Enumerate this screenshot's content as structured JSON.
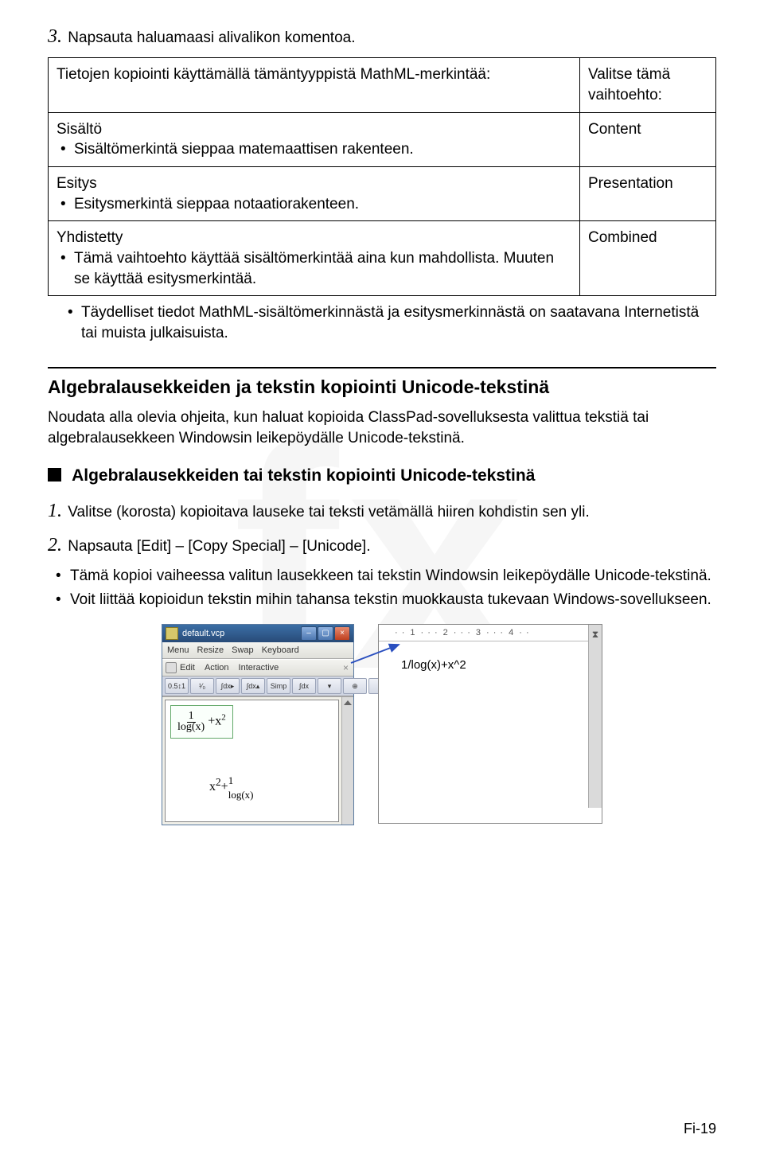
{
  "step3": "Napsauta haluamaasi alivalikon komentoa.",
  "table": {
    "header_left": "Tietojen kopiointi käyttämällä tämäntyyppistä MathML-merkintää:",
    "header_right": "Valitse tämä vaihtoehto:",
    "rows": [
      {
        "title": "Sisältö",
        "desc": "Sisältömerkintä sieppaa matemaattisen rakenteen.",
        "right": "Content"
      },
      {
        "title": "Esitys",
        "desc": "Esitysmerkintä sieppaa notaatiorakenteen.",
        "right": "Presentation"
      },
      {
        "title": "Yhdistetty",
        "desc": "Tämä vaihtoehto käyttää sisältömerkintää aina kun mahdollista. Muuten se käyttää esitysmerkintää.",
        "right": "Combined"
      }
    ]
  },
  "after_table_bullet": "Täydelliset tiedot MathML-sisältömerkinnästä ja esitysmerkinnästä on saatavana Internetistä tai muista julkaisuista.",
  "section_heading": "Algebralausekkeiden ja tekstin kopiointi Unicode-tekstinä",
  "para1": "Noudata alla olevia ohjeita, kun haluat kopioida ClassPad-sovelluksesta valittua tekstiä tai algebralausekkeen Windowsin leikepöydälle Unicode-tekstinä.",
  "sub_heading": "Algebralausekkeiden tai tekstin kopiointi Unicode-tekstinä",
  "step1": "Valitse (korosta) kopioitava lauseke tai teksti vetämällä hiiren kohdistin sen yli.",
  "step2_main": "Napsauta [Edit] – [Copy Special] – [Unicode].",
  "step2_b1": "Tämä kopioi vaiheessa valitun lausekkeen tai tekstin Windowsin leikepöydälle Unicode-tekstinä.",
  "step2_b2": "Voit liittää kopioidun tekstin mihin tahansa tekstin muokkausta tukevaan Windows-sovellukseen.",
  "app": {
    "title": "default.vcp",
    "menu": [
      "Menu",
      "Resize",
      "Swap",
      "Keyboard"
    ],
    "submenu": [
      "Edit",
      "Action",
      "Interactive"
    ],
    "toolbar": [
      "0.5↕1",
      "¹⁄₀",
      "∫dx▸",
      "∫dx▴",
      "Simp",
      "∫dx",
      "▾",
      "⊕",
      "▸"
    ],
    "word_formula": "1/log(x)+x^2"
  },
  "footer": "Fi-19"
}
